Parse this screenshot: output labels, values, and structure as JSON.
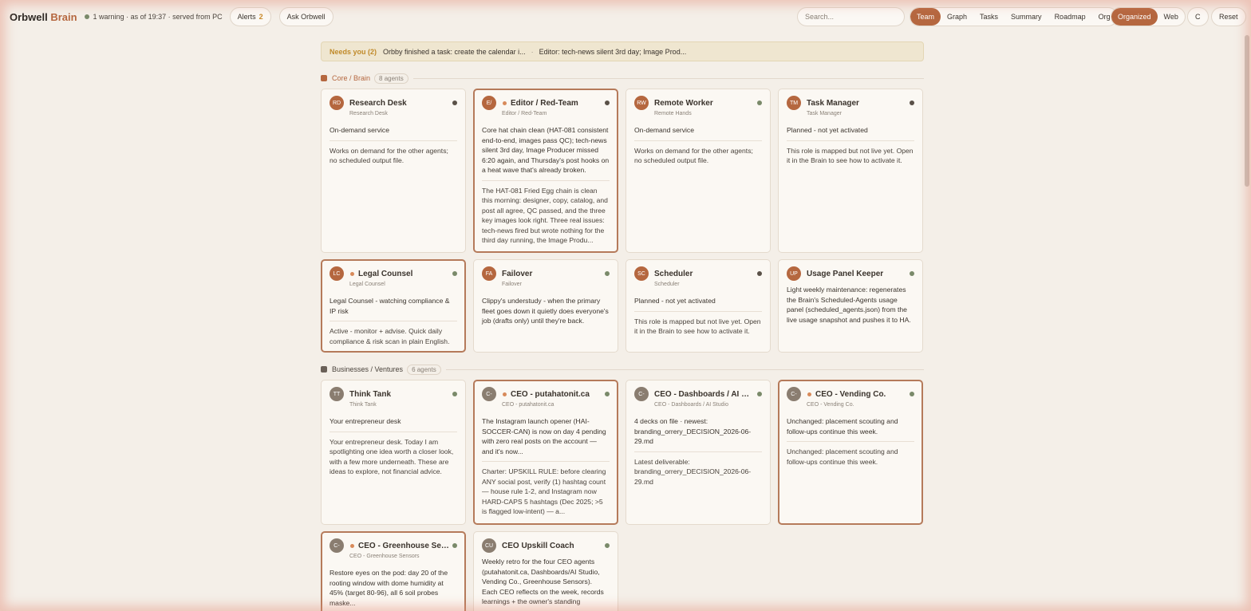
{
  "header": {
    "brand_main": "Orbwell",
    "brand_accent": "Brain",
    "status": "1 warning · as of 19:37 · served from PC",
    "alerts_label": "Alerts",
    "alerts_count": "2",
    "ask_label": "Ask Orbwell",
    "search_placeholder": "Search...",
    "views": [
      "Team",
      "Graph",
      "Tasks",
      "Summary",
      "Roadmap",
      "Org"
    ],
    "modes": [
      "Organized",
      "Web"
    ],
    "c_label": "C",
    "reset_label": "Reset"
  },
  "notice": {
    "label": "Needs you (2)",
    "item1": "Orbby finished a task: create the calendar i...",
    "sep": "·",
    "item2": "Editor: tech-news silent 3rd day; Image Prod..."
  },
  "colors": {
    "accent": "#b5673f",
    "ok": "#7a8a6a",
    "idle": "#5a5148",
    "attention": "#d88a5a"
  },
  "sections": [
    {
      "title": "Core / Brain",
      "count": "8 agents",
      "color": "#b5673f",
      "cards": [
        {
          "initials": "RD",
          "name": "Research Desk",
          "sub": "Research Desk",
          "summary": "On-demand service",
          "body": "Works on demand for the other agents; no scheduled output file."
        },
        {
          "initials": "E/",
          "name": "Editor / Red-Team",
          "sub": "Editor / Red-Team",
          "summary": "Core hat chain clean (HAT-081 consistent end-to-end, images pass QC); tech-news silent 3rd day, Image Producer missed 6:20 again, and Thursday's post hooks on a heat wave that's already broken.",
          "body": "The HAT-081 Fried Egg chain is clean this morning: designer, copy, catalog, and post all agree, QC passed, and the three key images look right. Three real issues: tech-news fired but wrote nothing for the third day running, the Image Produ..."
        },
        {
          "initials": "RW",
          "name": "Remote Worker",
          "sub": "Remote Hands",
          "summary": "On-demand service",
          "body": "Works on demand for the other agents; no scheduled output file."
        },
        {
          "initials": "TM",
          "name": "Task Manager",
          "sub": "Task Manager",
          "summary": "Planned - not yet activated",
          "body": "This role is mapped but not live yet. Open it in the Brain to see how to activate it."
        },
        {
          "initials": "LC",
          "name": "Legal Counsel",
          "sub": "Legal Counsel",
          "summary": "Legal Counsel - watching compliance & IP risk",
          "body": "Active - monitor + advise. Quick daily compliance & risk scan in plain English."
        },
        {
          "initials": "FA",
          "name": "Failover",
          "sub": "Failover",
          "summary": "Clippy's understudy - when the primary fleet goes down it quietly does everyone's job (drafts only) until they're back.",
          "body": ""
        },
        {
          "initials": "SC",
          "name": "Scheduler",
          "sub": "Scheduler",
          "summary": "Planned - not yet activated",
          "body": "This role is mapped but not live yet. Open it in the Brain to see how to activate it."
        },
        {
          "initials": "UP",
          "name": "Usage Panel Keeper",
          "sub": "",
          "summary": "Light weekly maintenance: regenerates the Brain's Scheduled-Agents usage panel (scheduled_agents.json) from the live usage snapshot and pushes it to HA.",
          "body": ""
        }
      ]
    },
    {
      "title": "Businesses / Ventures",
      "count": "6 agents",
      "color": "#6a6058",
      "cards": [
        {
          "initials": "TT",
          "name": "Think Tank",
          "sub": "Think Tank",
          "summary": "Your entrepreneur desk",
          "body": "Your entrepreneur desk. Today I am spotlighting one idea worth a closer look, with a few more underneath. These are ideas to explore, not financial advice."
        },
        {
          "initials": "C-",
          "name": "CEO - putahatonit.ca",
          "sub": "CEO - putahatonit.ca",
          "summary": "The Instagram launch opener (HAI-SOCCER-CAN) is now on day 4 pending with zero real posts on the account — and it's now...",
          "body": "Charter: UPSKILL RULE: before clearing ANY social post, verify (1) hashtag count — house rule 1-2, and Instagram now HARD-CAPS 5 hashtags (Dec 2025; >5 is flagged low-intent) — a..."
        },
        {
          "initials": "C-",
          "name": "CEO - Dashboards / AI Stu...",
          "sub": "CEO - Dashboards / AI Studio",
          "summary": "4 decks on file · newest: branding_orrery_DECISION_2026-06-29.md",
          "body": "Latest deliverable: branding_orrery_DECISION_2026-06-29.md"
        },
        {
          "initials": "C-",
          "name": "CEO - Vending Co.",
          "sub": "CEO - Vending Co.",
          "summary": "Unchanged: placement scouting and follow-ups continue this week.",
          "body": "Unchanged: placement scouting and follow-ups continue this week."
        },
        {
          "initials": "C-",
          "name": "CEO - Greenhouse Sens...",
          "sub": "CEO - Greenhouse Sensors",
          "summary": "Restore eyes on the pod: day 20 of the rooting window with dome humidity at 45% (target 80-96), all 6 soil probes maske...",
          "body": ""
        },
        {
          "initials": "CU",
          "name": "CEO Upskill Coach",
          "sub": "",
          "summary": "Weekly retro for the four CEO agents (putahatonit.ca, Dashboards/AI Studio, Vending Co., Greenhouse Sensors). Each CEO reflects on the week, records learnings + the owner's standing",
          "body": ""
        }
      ]
    }
  ]
}
